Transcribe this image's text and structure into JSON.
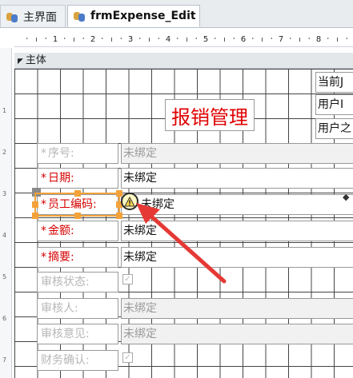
{
  "tabs": [
    {
      "label": "主界面",
      "active": false
    },
    {
      "label": "frmExpense_Edit",
      "active": true
    }
  ],
  "ruler": {
    "h_numbers": [
      "1",
      "2",
      "3",
      "4",
      "5",
      "6",
      "7",
      "8"
    ],
    "v_numbers": [
      "1",
      "2",
      "3",
      "4",
      "5",
      "6",
      "7"
    ]
  },
  "section": {
    "label": "主体"
  },
  "form": {
    "title": "报销管理",
    "header_boxes": [
      "当前J",
      "用户I",
      "用户之"
    ],
    "rows": [
      {
        "label": "序号:",
        "value": "未绑定",
        "required": true,
        "enabled": false,
        "kind": "text"
      },
      {
        "label": "日期:",
        "value": "未绑定",
        "required": true,
        "enabled": true,
        "kind": "text"
      },
      {
        "label": "员工编码:",
        "value": "未绑定",
        "required": true,
        "enabled": true,
        "kind": "text",
        "selected": true,
        "warning": true
      },
      {
        "label": "金额:",
        "value": "未绑定",
        "required": true,
        "enabled": true,
        "kind": "text"
      },
      {
        "label": "摘要:",
        "value": "未绑定",
        "required": true,
        "enabled": true,
        "kind": "text"
      },
      {
        "label": "审核状态:",
        "value": "✓",
        "required": false,
        "enabled": false,
        "kind": "checkbox"
      },
      {
        "label": "审核人:",
        "value": "未绑定",
        "required": false,
        "enabled": false,
        "kind": "text"
      },
      {
        "label": "审核意见:",
        "value": "未绑定",
        "required": false,
        "enabled": false,
        "kind": "text"
      },
      {
        "label": "财务确认:",
        "value": "✓",
        "required": false,
        "enabled": false,
        "kind": "checkbox"
      }
    ]
  },
  "colors": {
    "required_label": "#d40000",
    "title_text": "#e00000",
    "selection": "#f3a23a",
    "annotation_arrow": "#e53935"
  },
  "icons": {
    "form_tab": "users-icon",
    "warning": "warning-icon",
    "section": "section-collapse-icon"
  }
}
